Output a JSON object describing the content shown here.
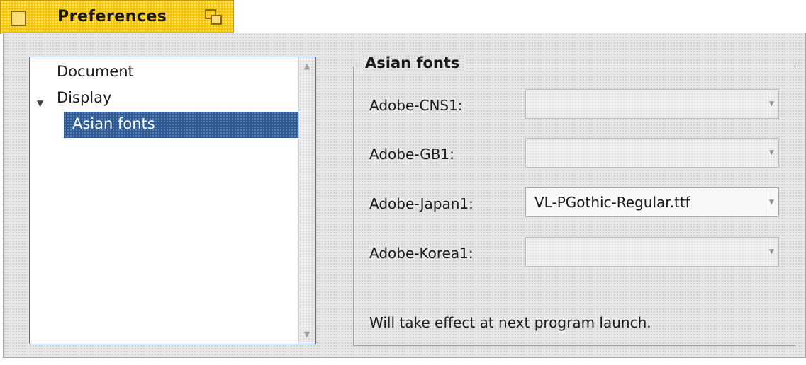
{
  "tab": {
    "title": "Preferences"
  },
  "tree": {
    "items": [
      {
        "label": "Document"
      },
      {
        "label": "Display"
      },
      {
        "label": "Asian fonts"
      }
    ]
  },
  "group": {
    "title": "Asian fonts",
    "rows": [
      {
        "label": "Adobe-CNS1:",
        "value": ""
      },
      {
        "label": "Adobe-GB1:",
        "value": ""
      },
      {
        "label": "Adobe-Japan1:",
        "value": "VL-PGothic-Regular.ttf"
      },
      {
        "label": "Adobe-Korea1:",
        "value": ""
      }
    ],
    "note": "Will take effect at next program launch."
  },
  "colors": {
    "tab_background": "#f5c400",
    "selection_background": "#2e5a93",
    "selection_text": "#ffffff",
    "tree_border": "#4a74b0"
  },
  "icons": {
    "tab_close": "close-box-icon",
    "tab_zoom": "zoom-icon",
    "tree_expander": "chevron-down-icon",
    "combo_arrow": "chevron-down-icon"
  }
}
